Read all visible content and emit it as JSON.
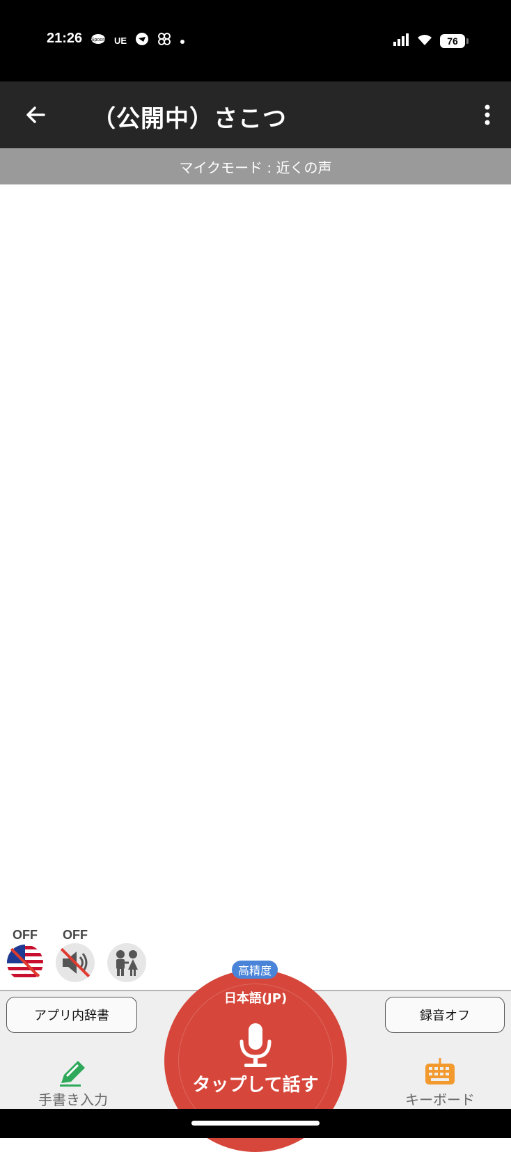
{
  "status_bar": {
    "time": "21:26",
    "left_icons": [
      "spoon-app-icon",
      "ue-app-icon",
      "chat-app-icon",
      "fan-app-icon",
      "dot-indicator"
    ],
    "ue_text": "UE",
    "battery_level": "76"
  },
  "app_bar": {
    "title": "（公開中）さこつ"
  },
  "mode_bar": {
    "text": "マイクモード : 近くの声"
  },
  "toggles": {
    "translate_label": "OFF",
    "speaker_label": "OFF"
  },
  "buttons": {
    "dictionary": "アプリ内辞書",
    "recording": "録音オフ"
  },
  "tools": {
    "handwriting": "手書き入力",
    "keyboard": "キーボード"
  },
  "mic": {
    "precision": "高精度",
    "language": "日本語(JP)",
    "tap_label": "タップして話す"
  },
  "colors": {
    "mic_red": "#d6463a",
    "badge_blue": "#4a84d8",
    "pen_green": "#2ea95a",
    "keyboard_orange": "#f29a2e"
  }
}
